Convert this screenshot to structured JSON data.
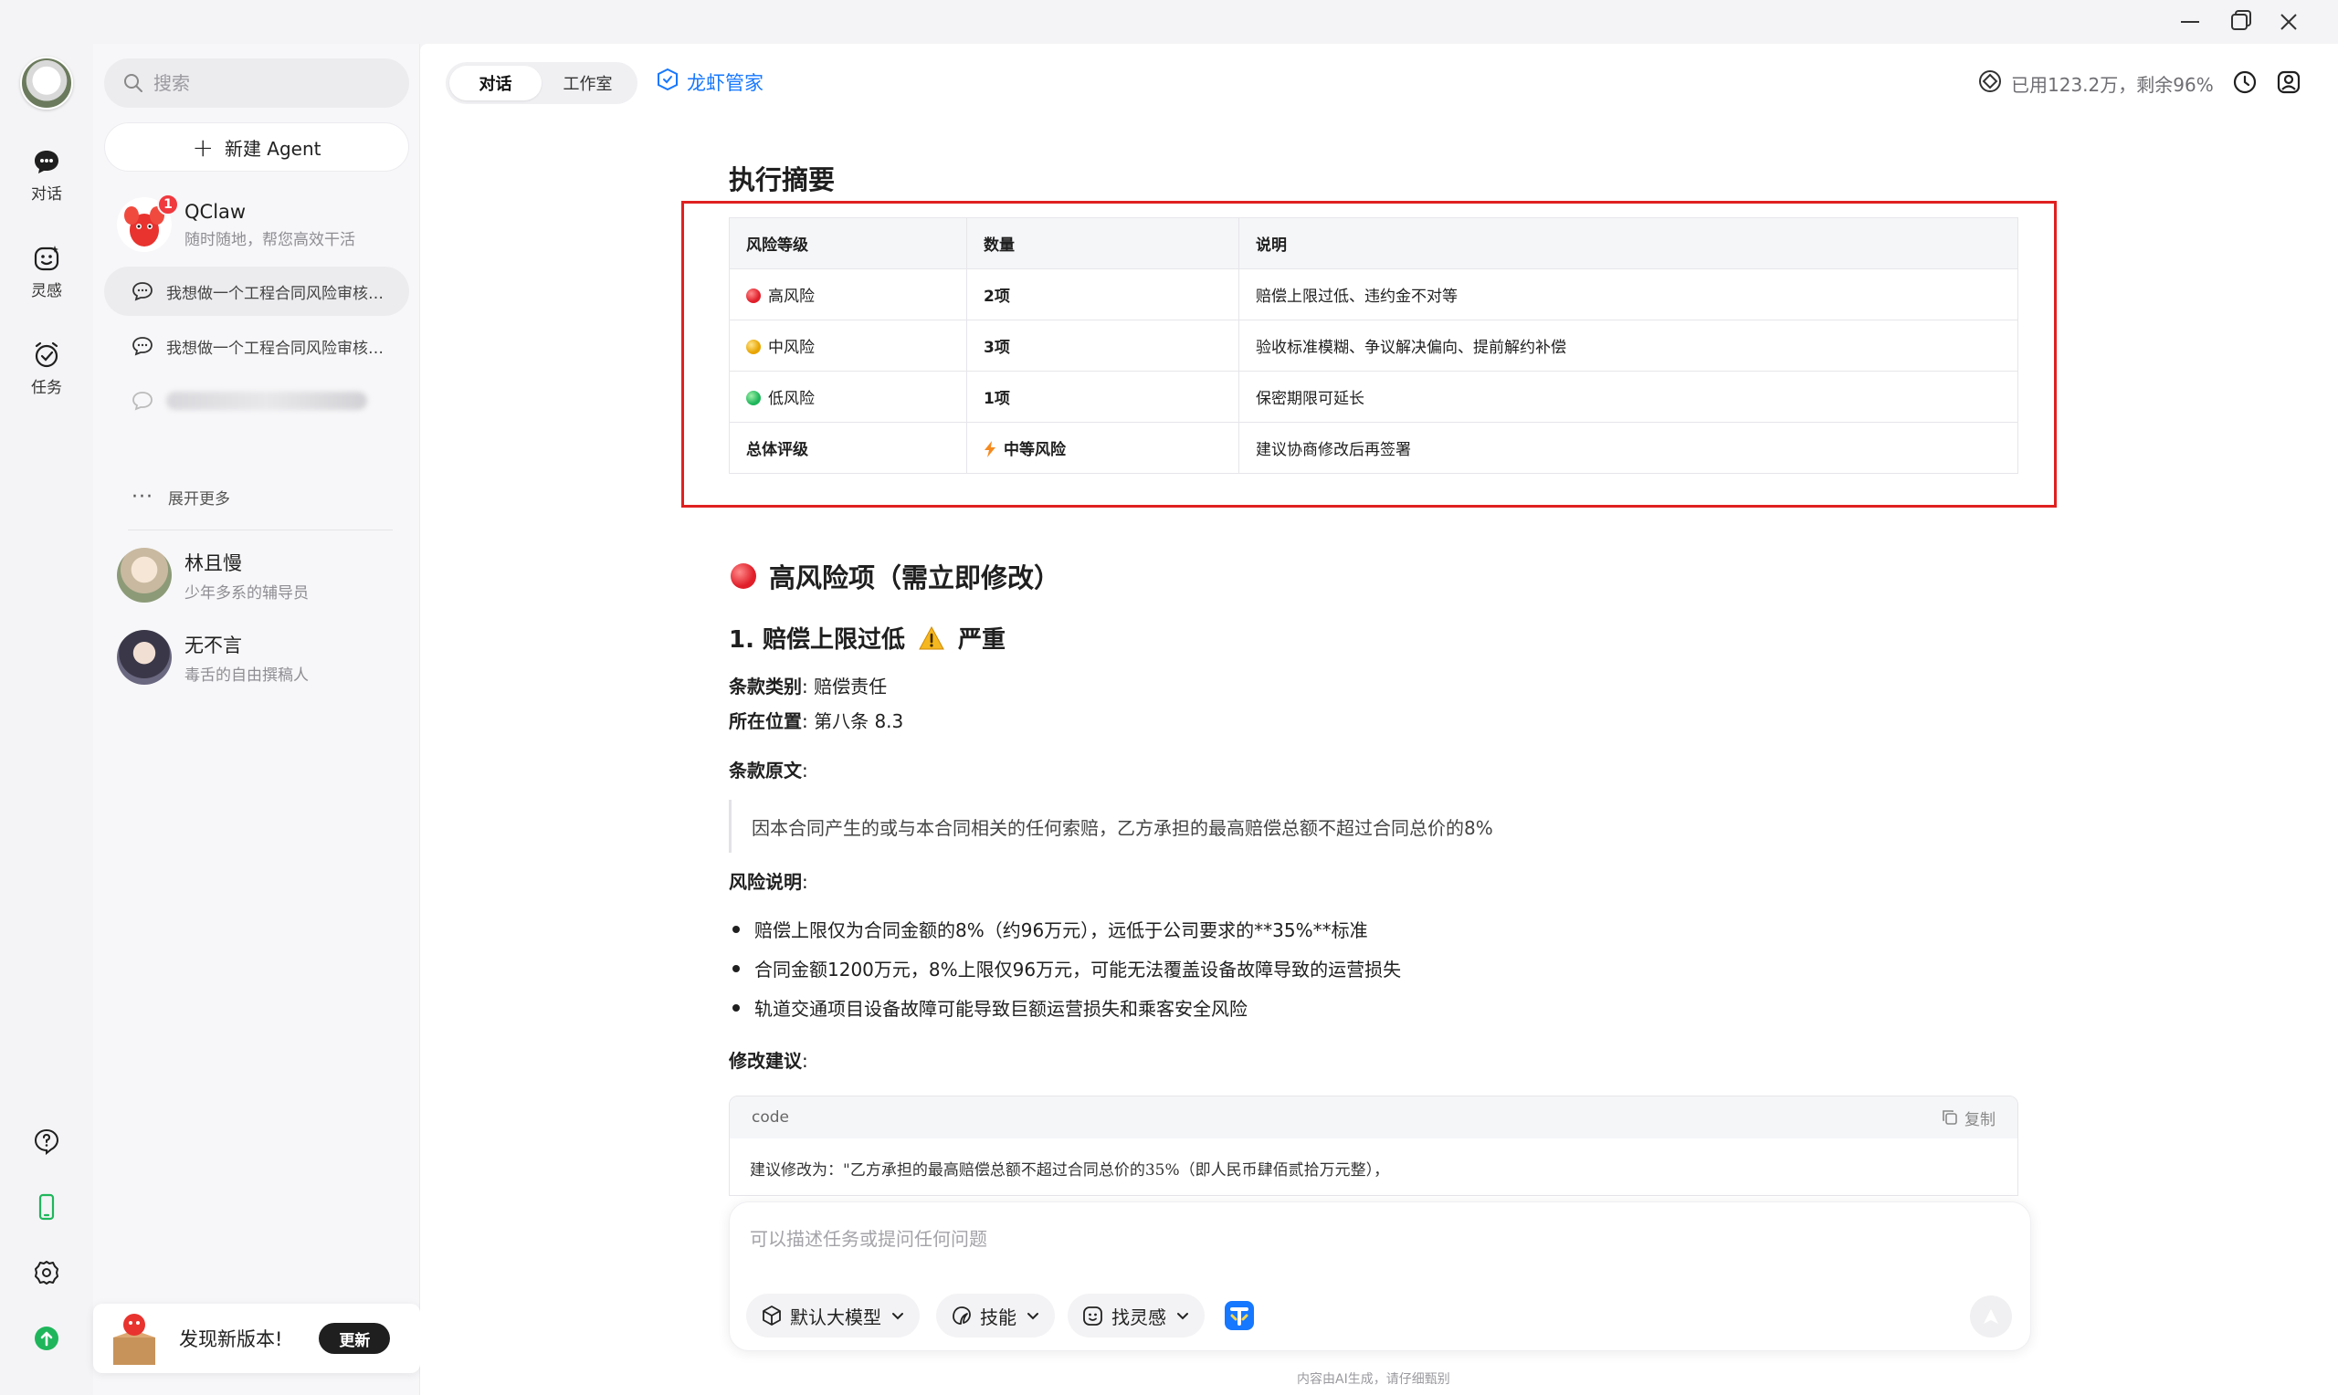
{
  "window": {
    "minimize": "minimize",
    "maximize": "maximize",
    "close": "close"
  },
  "rail": {
    "chat": "对话",
    "inspiration": "灵感",
    "tasks": "任务"
  },
  "sidebar": {
    "search_placeholder": "搜索",
    "new_agent": "新建 Agent",
    "agents": [
      {
        "name": "QClaw",
        "sub": "随时随地，帮您高效干活",
        "badge": "1"
      },
      {
        "name": "林且慢",
        "sub": "少年多系的辅导员"
      },
      {
        "name": "无不言",
        "sub": "毒舌的自由撰稿人"
      }
    ],
    "conversations": [
      "我想做一个工程合同风险审核的技能",
      "我想做一个工程合同风险审核的技能"
    ],
    "more": "展开更多",
    "update": {
      "text": "发现新版本!",
      "button": "更新"
    }
  },
  "header": {
    "tabs": [
      "对话",
      "工作室"
    ],
    "brand": "龙虾管家",
    "usage": "已用123.2万，剩余96%"
  },
  "doc": {
    "summary_title": "执行摘要",
    "table": {
      "headers": [
        "风险等级",
        "数量",
        "说明"
      ],
      "rows": [
        {
          "level": "高风险",
          "count": "2项",
          "desc": "赔偿上限过低、违约金不对等"
        },
        {
          "level": "中风险",
          "count": "3项",
          "desc": "验收标准模糊、争议解决偏向、提前解约补偿"
        },
        {
          "level": "低风险",
          "count": "1项",
          "desc": "保密期限可延长"
        },
        {
          "level": "总体评级",
          "count": "中等风险",
          "desc": "建议协商修改后再签署"
        }
      ]
    },
    "high_title": "高风险项（需立即修改）",
    "item_title": "1. 赔偿上限过低",
    "item_severity": "严重",
    "clause_type_label": "条款类别",
    "clause_type": ": 赔偿责任",
    "location_label": "所在位置",
    "location": ": 第八条 8.3",
    "original_label": "条款原文",
    "colon": ":",
    "original_text": "因本合同产生的或与本合同相关的任何索赔，乙方承担的最高赔偿总额不超过合同总价的8%",
    "risk_label": "风险说明",
    "risk_points": [
      "赔偿上限仅为合同金额的8%（约96万元），远低于公司要求的**35%**标准",
      "合同金额1200万元，8%上限仅96万元，可能无法覆盖设备故障导致的运营损失",
      "轨道交通项目设备故障可能导致巨额运营损失和乘客安全风险"
    ],
    "suggest_label": "修改建议",
    "code_lang": "code",
    "copy": "复制",
    "code_text": "建议修改为：\"乙方承担的最高赔偿总额不超过合同总价的35%（即人民币肆佰贰拾万元整），"
  },
  "composer": {
    "placeholder": "可以描述任务或提问任何问题",
    "model": "默认大模型",
    "skills": "技能",
    "inspiration": "找灵感"
  },
  "footnote": "内容由AI生成，请仔细甄别"
}
